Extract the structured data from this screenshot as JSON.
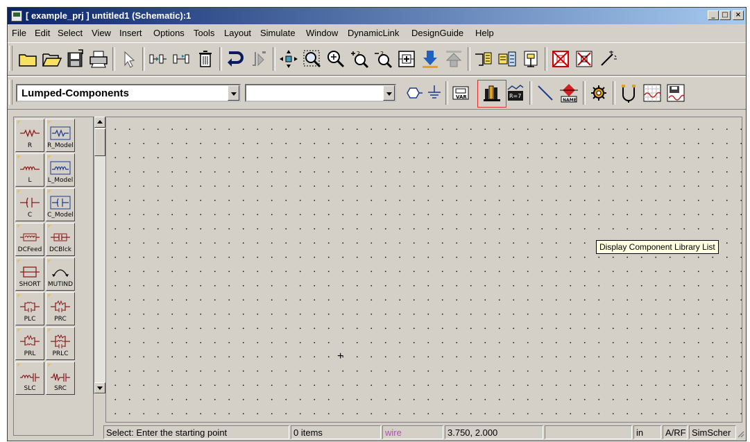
{
  "window": {
    "title": "[ example_prj ] untitled1 (Schematic):1",
    "minimize_glyph": "_",
    "maximize_glyph": "□",
    "close_glyph": "×"
  },
  "menu": [
    "File",
    "Edit",
    "Select",
    "View",
    "Insert",
    "Options",
    "Tools",
    "Layout",
    "Simulate",
    "Window",
    "DynamicLink",
    "DesignGuide",
    "Help"
  ],
  "toolbar1": {
    "buttons": [
      "new-folder-icon",
      "open-folder-icon",
      "save-icon",
      "print-icon",
      "select-arrow-icon",
      "rotate-icon",
      "mirror-icon",
      "delete-icon",
      "undo-icon",
      "redo-icon",
      "move-icon",
      "zoom-area-icon",
      "zoom-in-icon",
      "zoom-plus-icon",
      "zoom-minus-icon",
      "push-into-icon",
      "push-down-icon",
      "pop-up-icon",
      "wire-icon",
      "component-icon",
      "port-icon",
      "deactivate-icon",
      "short-icon",
      "wand-icon"
    ]
  },
  "toolbar2": {
    "palette_select": "Lumped-Components",
    "component_select": "",
    "buttons": [
      "port-hexagon-icon",
      "ground-icon",
      "var-icon",
      "component-library-icon",
      "var-eqn-icon",
      "insert-wire-icon",
      "name-icon",
      "gear-icon",
      "probe-icon",
      "graph-icon",
      "simulate-icon"
    ],
    "var_label": "VAR",
    "name_label": "NAME",
    "eqn_label": "R=7"
  },
  "tooltip": "Display Component Library List",
  "palette": [
    {
      "label": "R",
      "icon": "resistor-icon"
    },
    {
      "label": "R_Model",
      "icon": "resistor-model-icon"
    },
    {
      "label": "L",
      "icon": "inductor-icon"
    },
    {
      "label": "L_Model",
      "icon": "inductor-model-icon"
    },
    {
      "label": "C",
      "icon": "capacitor-icon"
    },
    {
      "label": "C_Model",
      "icon": "capacitor-model-icon"
    },
    {
      "label": "DCFeed",
      "icon": "dc-feed-icon"
    },
    {
      "label": "DCBlck",
      "icon": "dc-block-icon"
    },
    {
      "label": "SHORT",
      "icon": "short-icon"
    },
    {
      "label": "MUTIND",
      "icon": "mutual-inductor-icon"
    },
    {
      "label": "PLC",
      "icon": "plc-icon"
    },
    {
      "label": "PRC",
      "icon": "prc-icon"
    },
    {
      "label": "PRL",
      "icon": "prl-icon"
    },
    {
      "label": "PRLC",
      "icon": "prlc-icon"
    },
    {
      "label": "SLC",
      "icon": "slc-icon"
    },
    {
      "label": "SRC",
      "icon": "src-icon"
    }
  ],
  "canvas": {
    "cursor": "+"
  },
  "status": {
    "message": "Select: Enter the starting point",
    "items": "0 items",
    "mode": "wire",
    "coords": "3.750, 2.000",
    "empty": "",
    "units": "in",
    "lib": "A/RF",
    "tool": "SimScher"
  }
}
